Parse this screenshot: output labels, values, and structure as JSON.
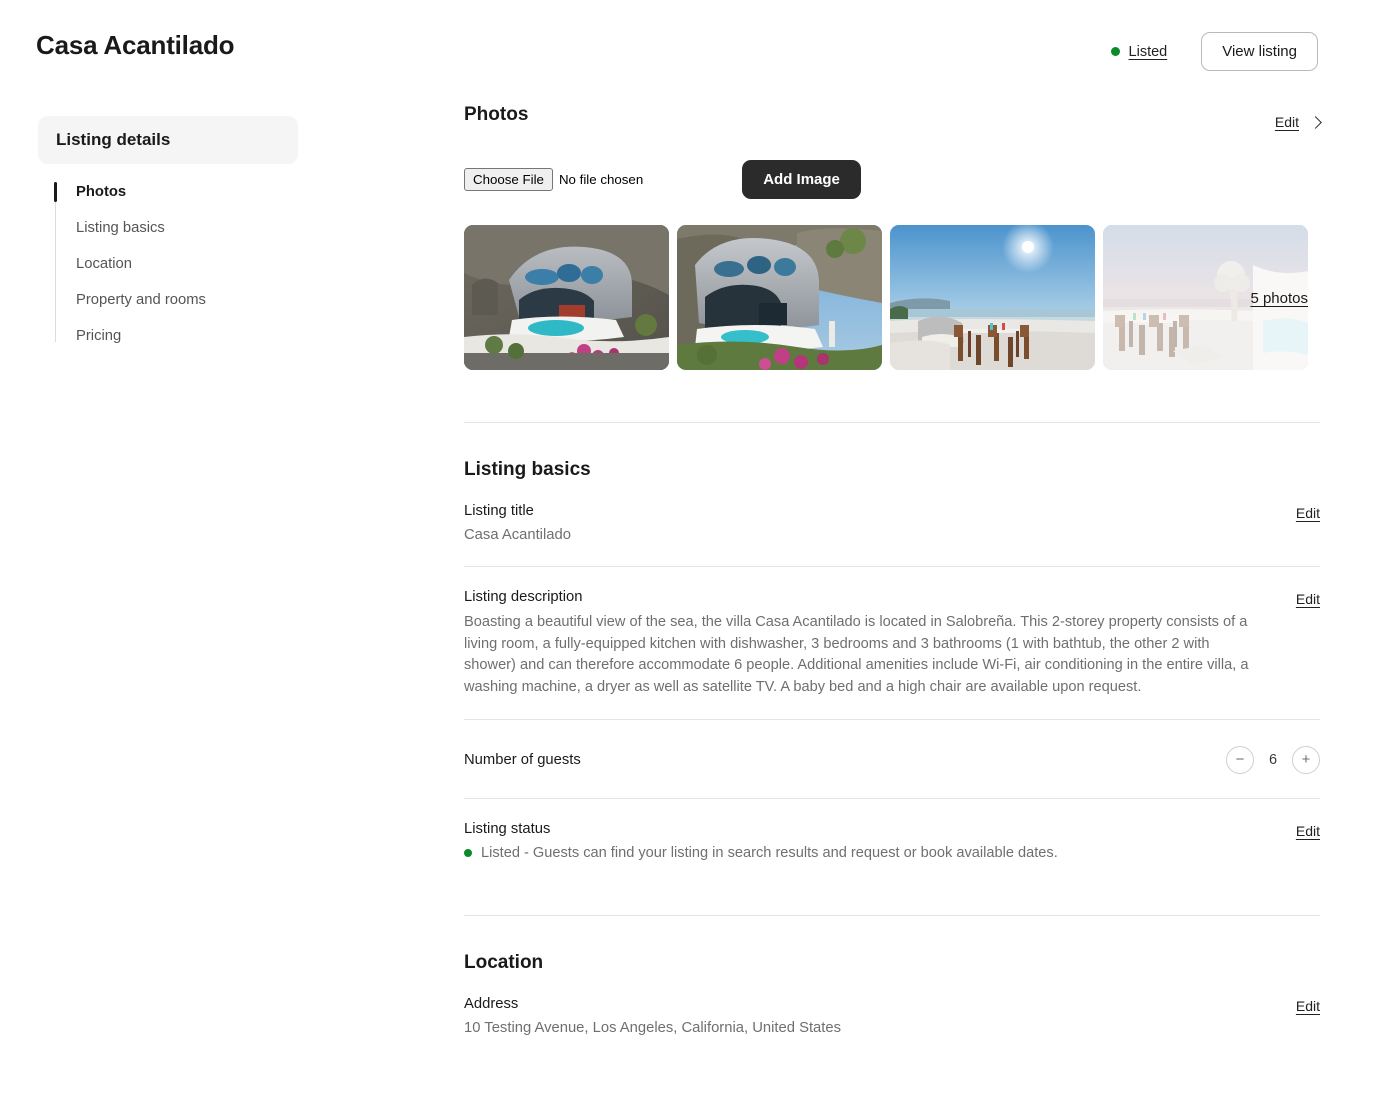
{
  "header": {
    "title": "Casa Acantilado",
    "status_label": "Listed",
    "status_dot_color": "#0a8a29",
    "view_listing_label": "View listing"
  },
  "sidebar": {
    "header": "Listing details",
    "items": [
      {
        "label": "Photos",
        "active": true
      },
      {
        "label": "Listing basics",
        "active": false
      },
      {
        "label": "Location",
        "active": false
      },
      {
        "label": "Property and rooms",
        "active": false
      },
      {
        "label": "Pricing",
        "active": false
      }
    ]
  },
  "photos": {
    "title": "Photos",
    "edit_label": "Edit",
    "file_button_label": "Choose File",
    "file_status": "No file chosen",
    "add_image_label": "Add Image",
    "more_photos_label": "5 photos"
  },
  "listing_basics": {
    "title": "Listing basics",
    "title_row": {
      "label": "Listing title",
      "value": "Casa Acantilado",
      "edit_label": "Edit"
    },
    "description_row": {
      "label": "Listing description",
      "value": "Boasting a beautiful view of the sea, the villa Casa Acantilado is located in Salobreña. This 2-storey property consists of a living room, a fully-equipped kitchen with dishwasher, 3 bedrooms and 3 bathrooms (1 with bathtub, the other 2 with shower) and can therefore accommodate 6 people. Additional amenities include Wi-Fi, air conditioning in the entire villa, a washing machine, a dryer as well as satellite TV. A baby bed and a high chair are available upon request.",
      "edit_label": "Edit"
    },
    "guests_row": {
      "label": "Number of guests",
      "value": "6",
      "decrement_label": "−",
      "increment_label": "+"
    },
    "status_row": {
      "label": "Listing status",
      "value": "Listed - Guests can find your listing in search results and request or book available dates.",
      "dot_color": "#0a8a29",
      "edit_label": "Edit"
    }
  },
  "location": {
    "title": "Location",
    "address_row": {
      "label": "Address",
      "value": "10 Testing Avenue, Los Angeles, California, United States",
      "edit_label": "Edit"
    }
  }
}
